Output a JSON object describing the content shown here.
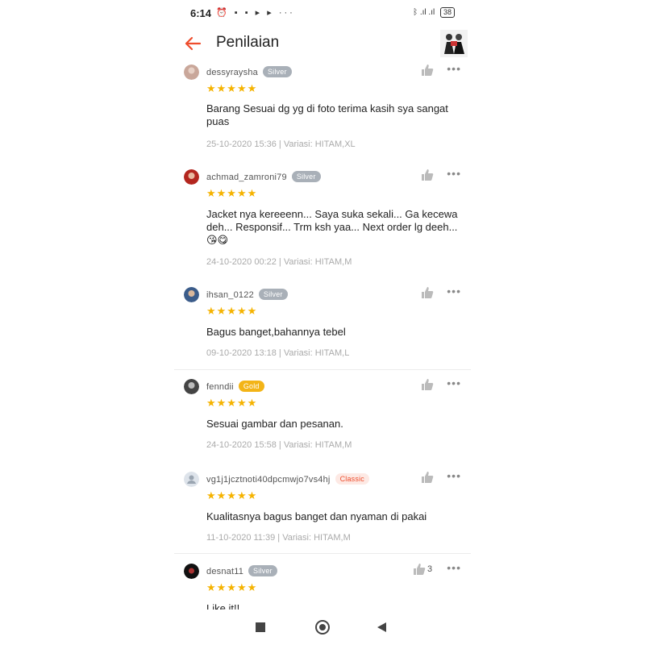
{
  "statusbar": {
    "time": "6:14",
    "left_icons": "⏰ ▪ ▪ ▸ ▸ ···",
    "right_icons": "ᛒ .ıl .ıl",
    "battery": "38"
  },
  "header": {
    "title": "Penilaian"
  },
  "colors": {
    "accent": "#ee4d2d",
    "star": "#f5b301",
    "silver": "#a9b0b8",
    "gold": "#f3b417"
  },
  "reviews": [
    {
      "user": "dessyraysha",
      "badge": "Silver",
      "stars": "★★★★★",
      "text": " Barang Sesuai dg yg di foto terima kasih sya sangat puas",
      "meta": "25-10-2020 15:36 | Variasi: HITAM,XL",
      "likes": ""
    },
    {
      "user": "achmad_zamroni79",
      "badge": "Silver",
      "stars": "★★★★★",
      "text": "Jacket nya kereeenn... Saya suka sekali... Ga kecewa deh... Responsif... Trm ksh yaa... Next order lg deeh...",
      "emoji": "😘😋",
      "meta": "24-10-2020 00:22 | Variasi: HITAM,M",
      "likes": ""
    },
    {
      "user": "ihsan_0122",
      "badge": "Silver",
      "stars": "★★★★★",
      "text": "Bagus banget,bahannya tebel",
      "meta": "09-10-2020 13:18 | Variasi: HITAM,L",
      "likes": ""
    },
    {
      "user": "fenndii",
      "badge": "Gold",
      "stars": "★★★★★",
      "text": "Sesuai gambar dan pesanan.",
      "meta": "24-10-2020 15:58 | Variasi: HITAM,M",
      "likes": ""
    },
    {
      "user": "vg1j1jcztnoti40dpcmwjo7vs4hj",
      "badge": "Classic",
      "stars": "★★★★★",
      "text": "Kualitasnya bagus banget dan nyaman di pakai",
      "meta": "11-10-2020 11:39 | Variasi: HITAM,M",
      "likes": ""
    },
    {
      "user": "desnat11",
      "badge": "Silver",
      "stars": "★★★★★",
      "text": "Like it!!",
      "meta": "",
      "likes": "3"
    }
  ]
}
